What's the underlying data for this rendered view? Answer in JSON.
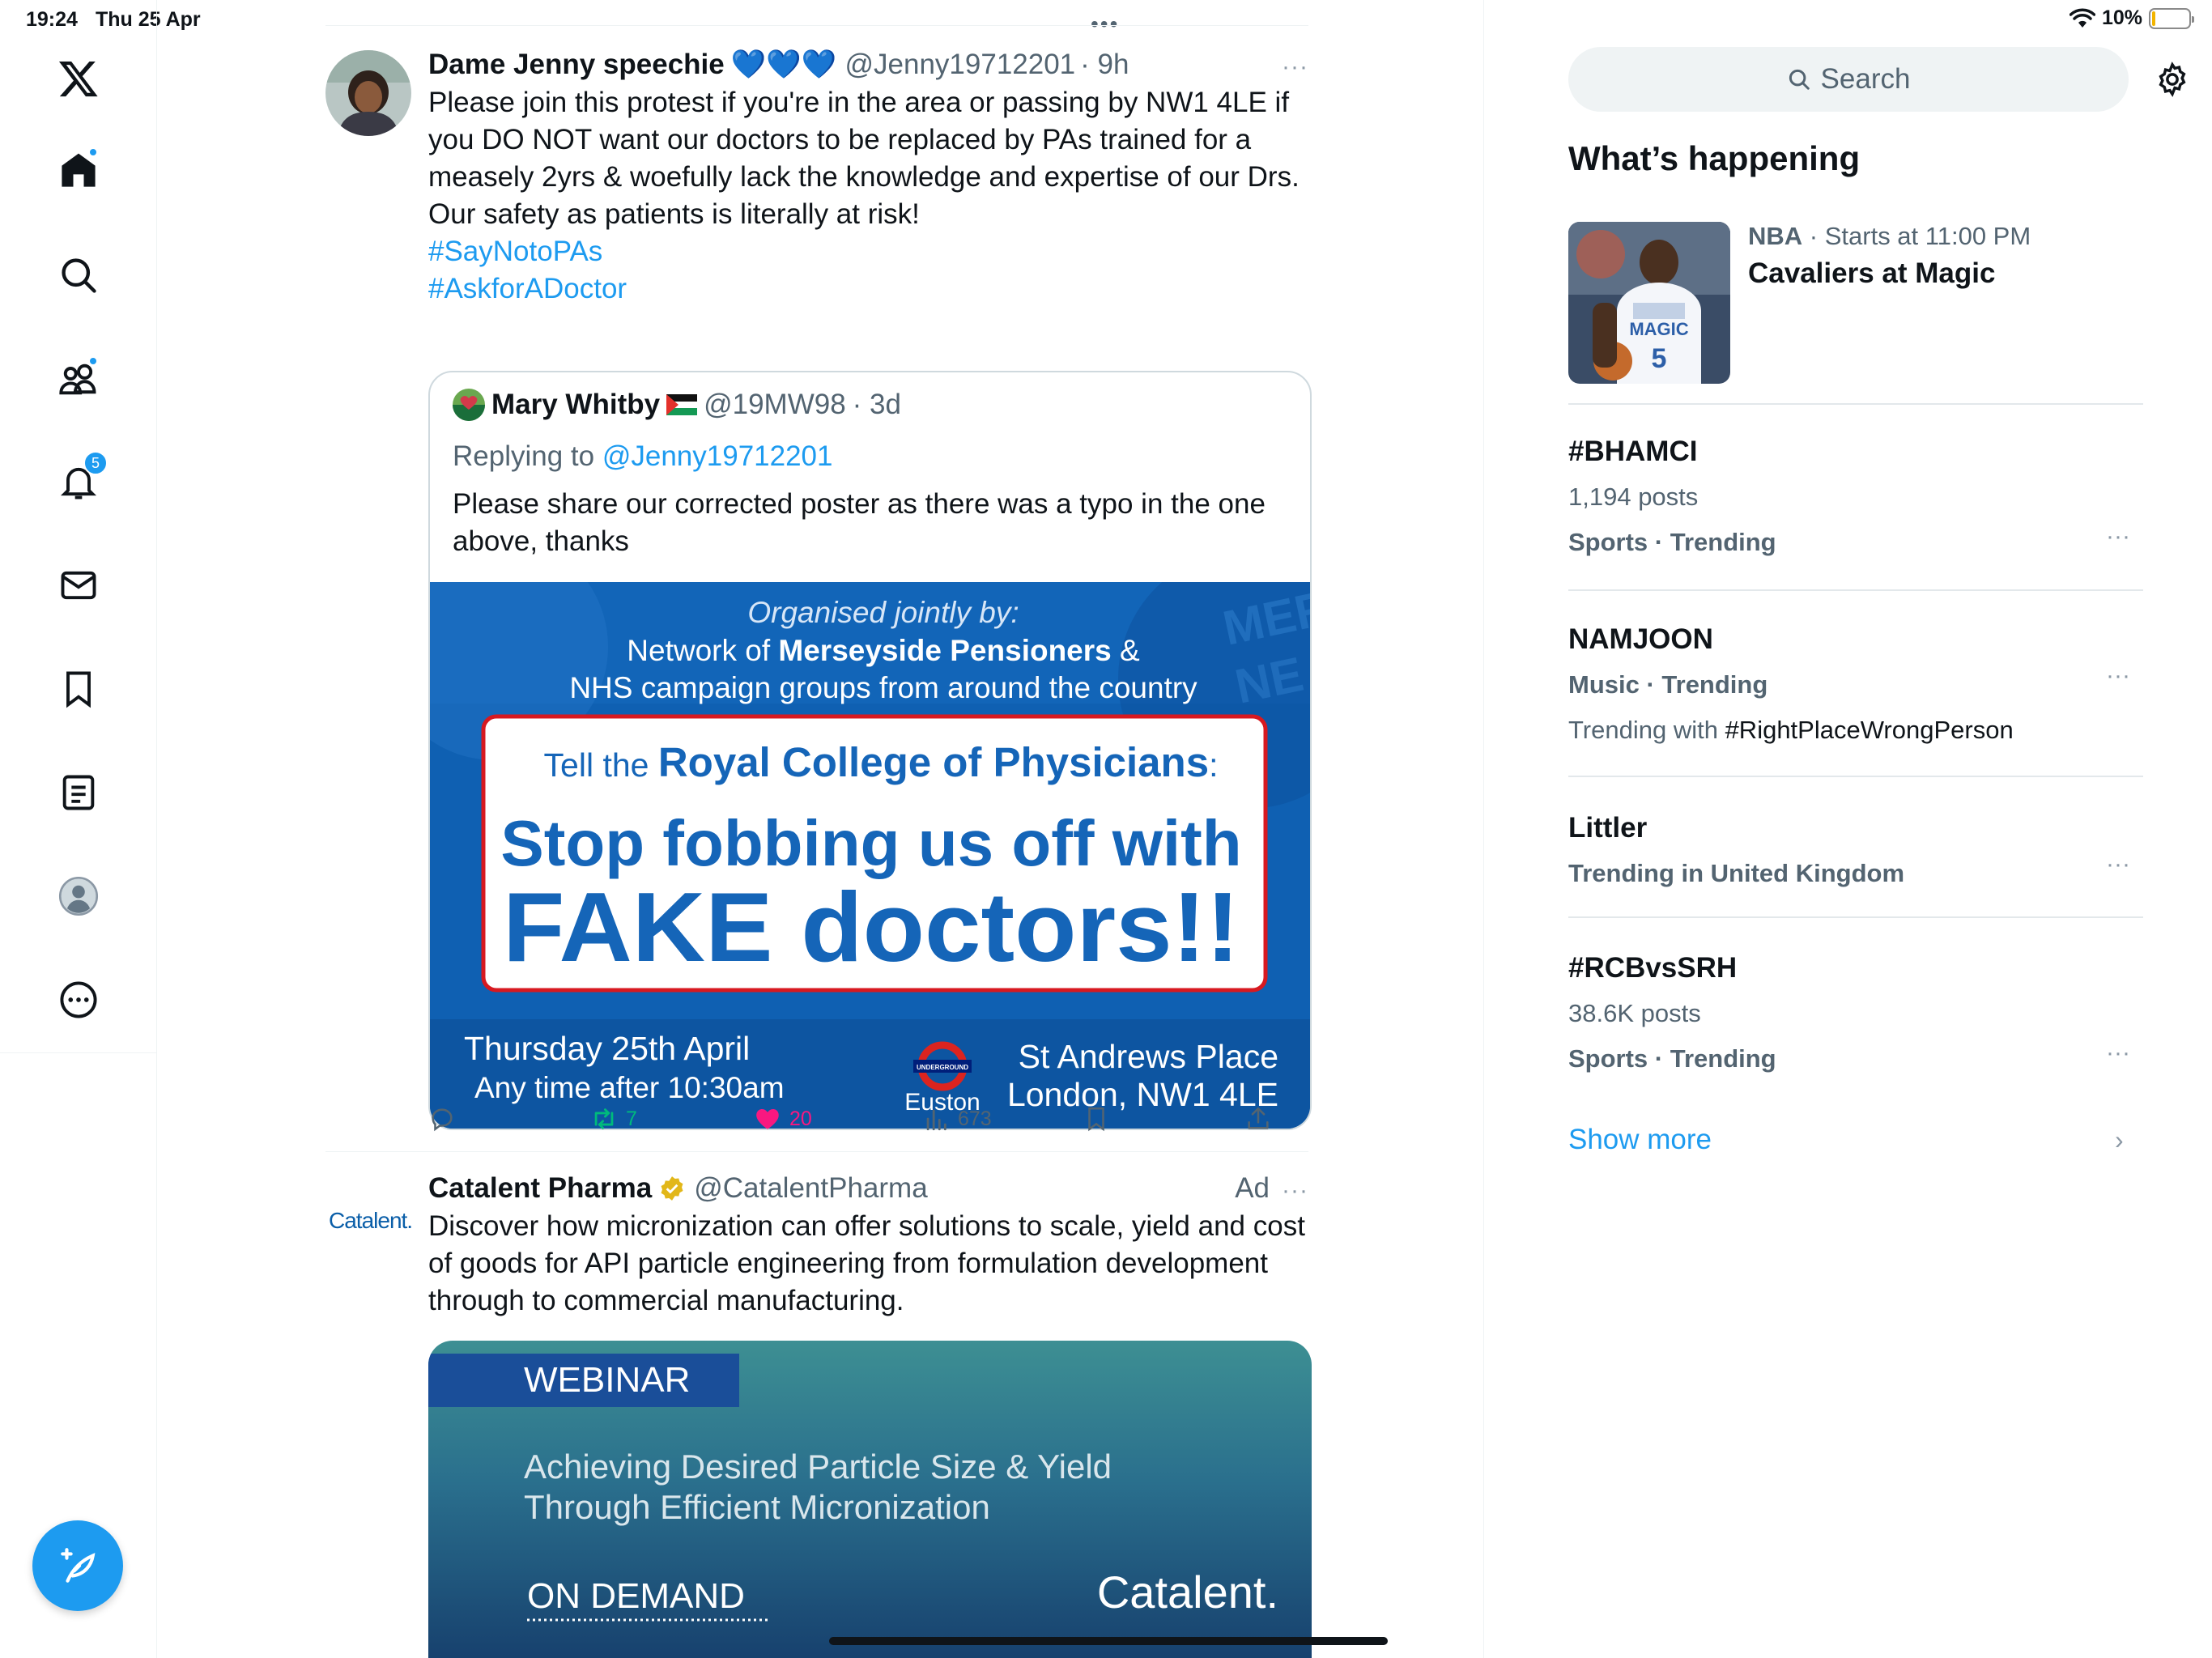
{
  "status_bar": {
    "time": "19:24",
    "date": "Thu 25 Apr",
    "battery": "10%",
    "battery_level": 0.1
  },
  "nav": {
    "home_has_dot": true,
    "communities_has_dot": true,
    "notifications_count": "5",
    "icons": [
      "x-logo-icon",
      "home-icon",
      "search-icon",
      "communities-icon",
      "notifications-icon",
      "messages-icon",
      "bookmarks-icon",
      "lists-icon",
      "profile-icon",
      "more-icon",
      "compose-icon"
    ]
  },
  "timeline": {
    "top_dots": "•••",
    "tweet1": {
      "name": "Dame Jenny speechie",
      "hearts": "💙💙💙",
      "handle": "@Jenny19712201",
      "time": "· 9h",
      "more": "···",
      "text": "Please join this protest if you're in the area or passing by NW1 4LE if you DO NOT want our doctors to be replaced by PAs trained for a measely 2yrs & woefully lack the knowledge and expertise of our Drs. Our safety as patients is literally at risk!",
      "hashtags": [
        "#SayNotoPAs",
        "#AskforADoctor"
      ],
      "quote": {
        "name": "Mary Whitby",
        "handle": "@19MW98",
        "time": "· 3d",
        "replying_prefix": "Replying to",
        "replying_handle": "@Jenny19712201",
        "text": "Please share our corrected poster as there was a typo in the one above, thanks",
        "poster": {
          "organised": "Organised jointly by:",
          "line1_pre": "Network of ",
          "line1_bold": "Merseyside Pensioners",
          "line1_post": " &",
          "line2": "NHS campaign groups from around the country",
          "tell_pre": "Tell the ",
          "tell_bold": "Royal College of Physicians",
          "tell_post": ":",
          "headline1": "Stop fobbing us off with",
          "headline2": "FAKE doctors!!",
          "date": "Thursday 25th April",
          "time": "Any time after 10:30am",
          "underground": "UNDERGROUND",
          "station": "Euston",
          "place1": "St Andrews Place",
          "place2": "London, NW1 4LE",
          "bg_word1": "MERSEYSI",
          "bg_word2": "NE"
        }
      },
      "actions": {
        "replies": "",
        "retweets": "7",
        "likes": "20",
        "views": "673"
      }
    },
    "tweet2": {
      "logo_text": "Catalent.",
      "name": "Catalent Pharma",
      "handle": "@CatalentPharma",
      "ad": "Ad",
      "more": "···",
      "text": "Discover how micronization can offer solutions to scale, yield and cost of goods for API particle engineering from formulation development through to commercial manufacturing.",
      "webinar": {
        "tag": "WEBINAR",
        "title1": "Achieving Desired Particle Size & Yield",
        "title2": "Through Efficient Micronization",
        "on_demand": "ON DEMAND",
        "brand": "Catalent."
      }
    }
  },
  "sidebar": {
    "search_placeholder": "Search",
    "section_title": "What’s happening",
    "event": {
      "league": "NBA",
      "meta": "· Starts at 11:00 PM",
      "title": "Cavaliers at Magic",
      "jersey_text": "MAGIC",
      "jersey_number": "5"
    },
    "trends": [
      {
        "name": "#BHAMCI",
        "posts": "1,194 posts",
        "category": "Sports · Trending"
      },
      {
        "name": "NAMJOON",
        "category": "Music · Trending",
        "with_prefix": "Trending with ",
        "with_tag": "#RightPlaceWrongPerson"
      },
      {
        "name": "Littler",
        "category": "Trending in United Kingdom"
      },
      {
        "name": "#RCBvsSRH",
        "posts": "38.6K posts",
        "category": "Sports · Trending"
      }
    ],
    "trend_more": "···",
    "show_more": "Show more",
    "show_more_chevron": "›"
  },
  "colors": {
    "accent": "#1d9bf0",
    "retweet": "#00ba7c",
    "like": "#f91880",
    "poster_blue": "#0e5fb5",
    "poster_border": "#d71920"
  }
}
